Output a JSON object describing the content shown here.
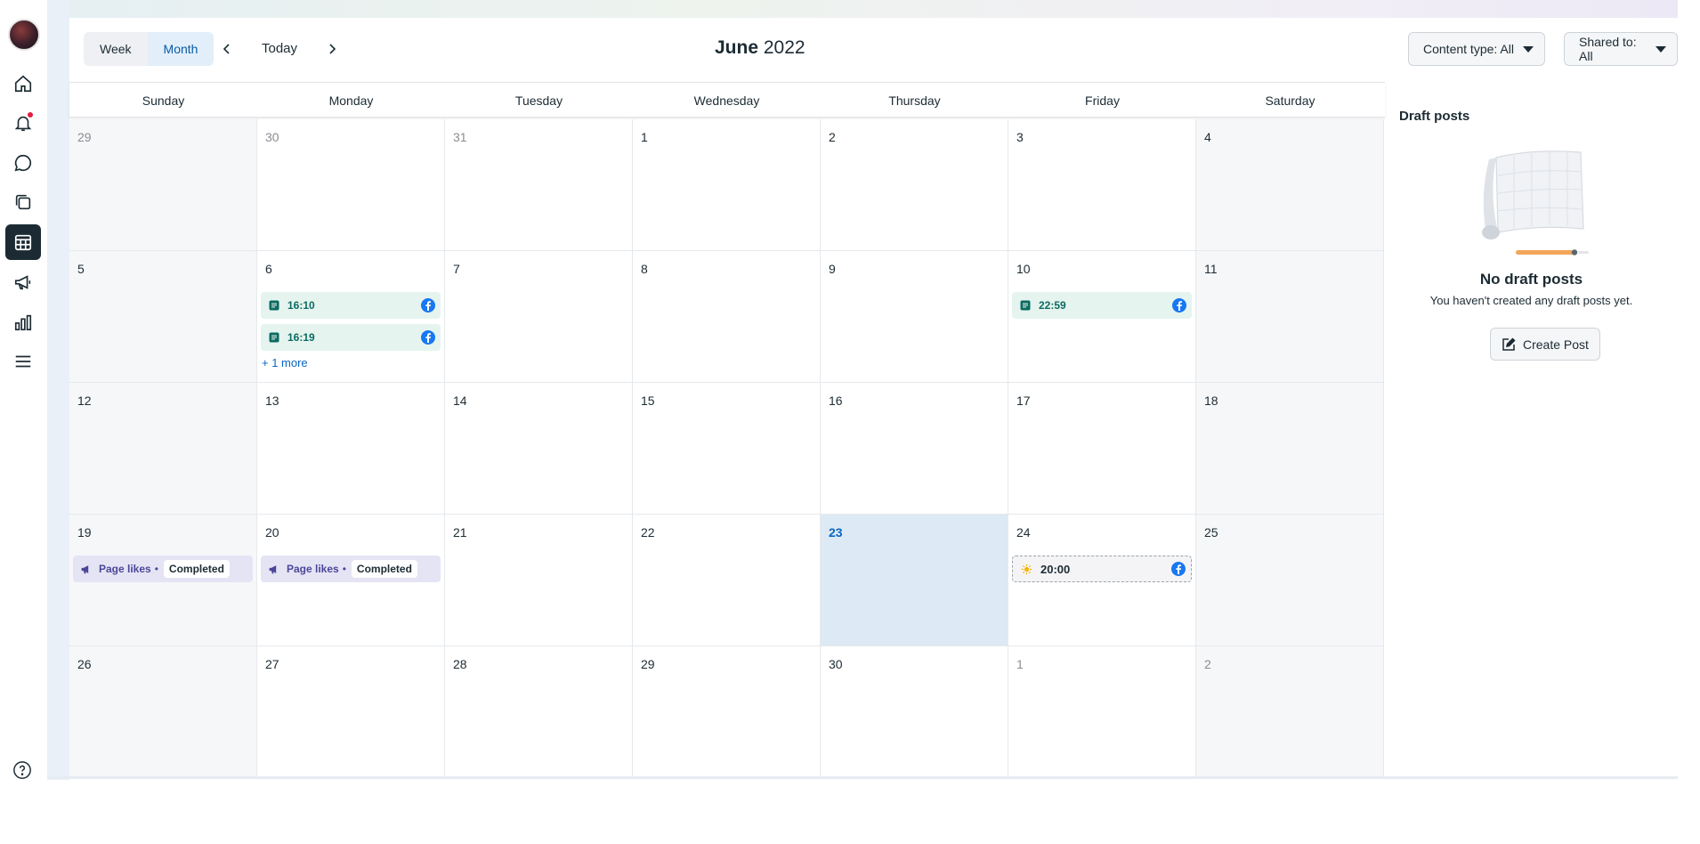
{
  "view_toggle": {
    "week": "Week",
    "month": "Month"
  },
  "nav": {
    "today": "Today"
  },
  "title": {
    "month": "June",
    "year": "2022"
  },
  "filters": {
    "content_type": "Content type: All",
    "shared_to": "Shared to: All"
  },
  "weekdays": [
    "Sunday",
    "Monday",
    "Tuesday",
    "Wednesday",
    "Thursday",
    "Friday",
    "Saturday"
  ],
  "weeks": [
    [
      "29",
      "30",
      "31",
      "1",
      "2",
      "3",
      "4"
    ],
    [
      "5",
      "6",
      "7",
      "8",
      "9",
      "10",
      "11"
    ],
    [
      "12",
      "13",
      "14",
      "15",
      "16",
      "17",
      "18"
    ],
    [
      "19",
      "20",
      "21",
      "22",
      "23",
      "24",
      "25"
    ],
    [
      "26",
      "27",
      "28",
      "29",
      "30",
      "1",
      "2"
    ]
  ],
  "events": {
    "w1_mon_post1": "16:10",
    "w1_mon_post2": "16:19",
    "w1_mon_more": "+ 1 more",
    "w1_fri_post": "22:59",
    "w3_sun_ad_label": "Page likes",
    "w3_sun_ad_status": "Completed",
    "w3_mon_ad_label": "Page likes",
    "w3_mon_ad_status": "Completed",
    "w3_fri_sched": "20:00"
  },
  "drafts": {
    "title": "Draft posts",
    "empty_title": "No draft posts",
    "empty_sub": "You haven't created any draft posts yet.",
    "create_label": "Create Post"
  },
  "colors": {
    "accent": "#0a66c2",
    "facebook": "#1877f2",
    "post_bg": "#e5f4ef",
    "ad_bg": "#e5e4f5",
    "today_bg": "#dde9f4"
  }
}
